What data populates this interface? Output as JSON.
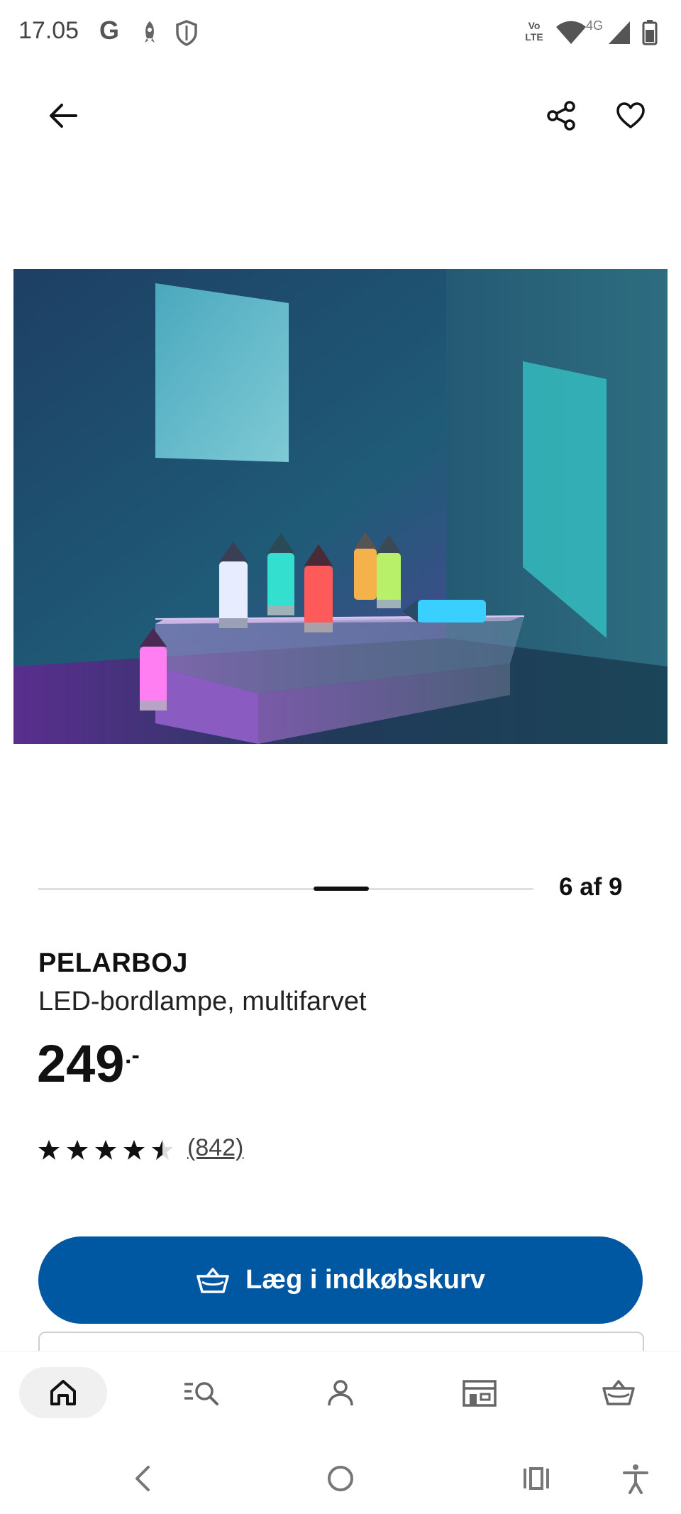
{
  "status_bar": {
    "time": "17.05",
    "google_icon": "G",
    "network_label": "4G",
    "volte_label": "Vo LTE"
  },
  "header": {
    "back_icon": "arrow-left-icon",
    "share_icon": "share-icon",
    "favourite_icon": "heart-icon"
  },
  "gallery": {
    "counter": "6 af 9",
    "current": 6,
    "total": 9
  },
  "product": {
    "name": "PELARBOJ",
    "description": "LED-bordlampe, multifarvet",
    "price": "249",
    "price_suffix": ".-",
    "rating_value": 4.5,
    "rating_count": "(842)"
  },
  "actions": {
    "add_to_basket": "Læg i indkøbskurv",
    "accent_color": "#0058a3"
  },
  "bottom_nav": [
    {
      "name": "home",
      "icon": "home-icon",
      "active": true
    },
    {
      "name": "search",
      "icon": "search-list-icon",
      "active": false
    },
    {
      "name": "profile",
      "icon": "user-icon",
      "active": false
    },
    {
      "name": "store",
      "icon": "store-icon",
      "active": false
    },
    {
      "name": "basket",
      "icon": "basket-icon",
      "active": false
    }
  ]
}
